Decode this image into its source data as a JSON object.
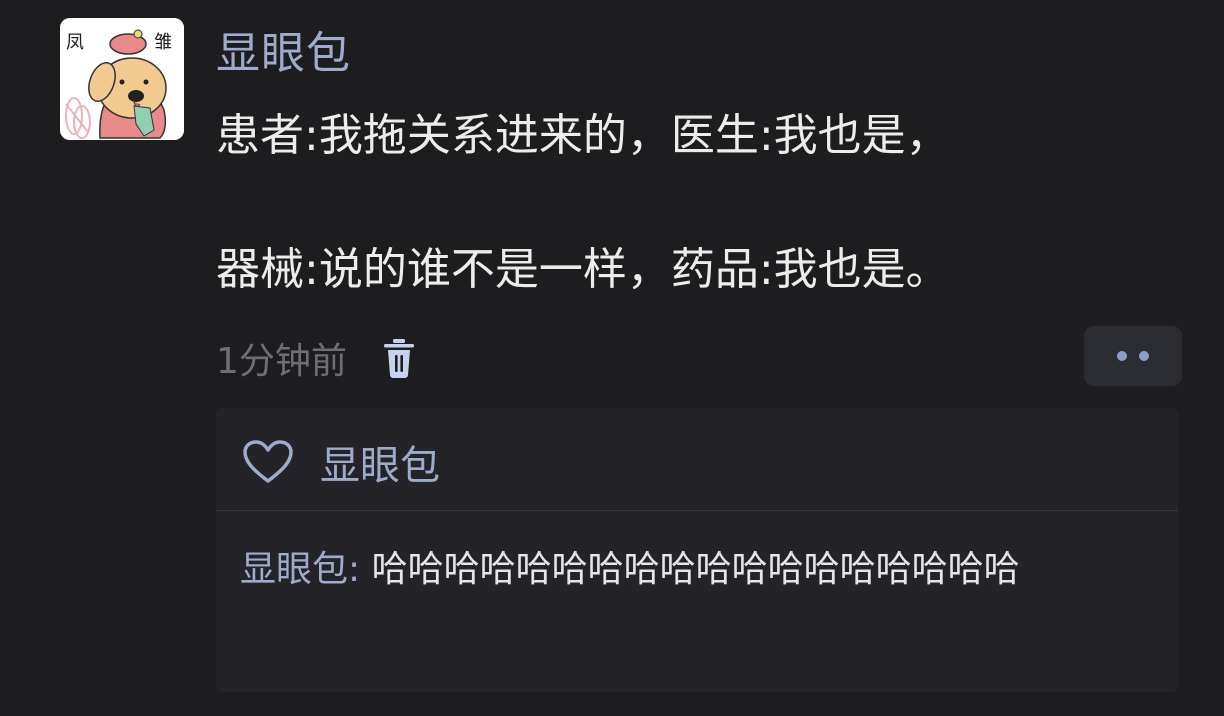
{
  "post": {
    "avatar_left_char": "凤",
    "avatar_right_char": "雏",
    "username": "显眼包",
    "line1": "患者:我拖关系进来的，医生:我也是，",
    "line2": "器械:说的谁不是一样，药品:我也是。",
    "time": "1分钟前",
    "icons": {
      "delete": "trash-icon",
      "more": "more-dots-icon"
    }
  },
  "likes": {
    "icon": "heart-icon",
    "name": "显眼包"
  },
  "reply": {
    "name": "显眼包",
    "separator": ": ",
    "text": "哈哈哈哈哈哈哈哈哈哈哈哈哈哈哈哈哈哈"
  },
  "colors": {
    "background": "#1d1d20",
    "username": "#9eabcb",
    "text": "#ececec",
    "muted": "#6e6f74",
    "reply_box": "#242428"
  }
}
